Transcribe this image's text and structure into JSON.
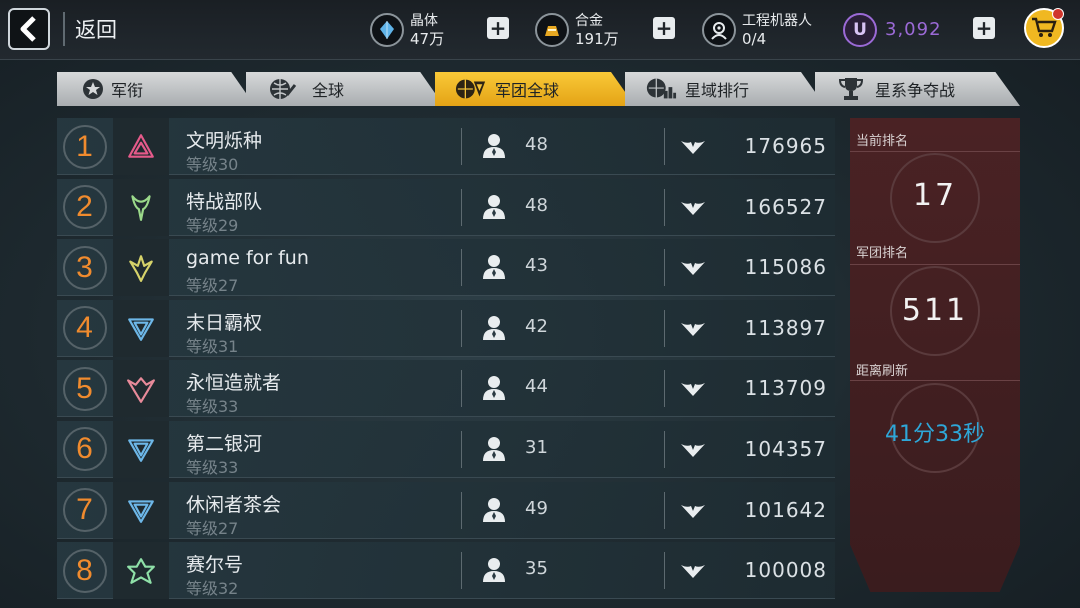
{
  "topbar": {
    "back_label": "返回",
    "resources": [
      {
        "name": "晶体",
        "value": "47万"
      },
      {
        "name": "合金",
        "value": "191万"
      },
      {
        "name": "工程机器人",
        "value": "0/4"
      }
    ],
    "currency_value": "3,092",
    "currency_color": "#9b6ad6"
  },
  "tabs": [
    {
      "label": "军衔",
      "icon": "rank-badge-icon",
      "active": false
    },
    {
      "label": "全球",
      "icon": "globe-icon",
      "active": false
    },
    {
      "label": "军团全球",
      "icon": "legion-globe-icon",
      "active": true
    },
    {
      "label": "星域排行",
      "icon": "galaxy-icon",
      "active": false
    },
    {
      "label": "星系争夺战",
      "icon": "trophy-icon",
      "active": false
    }
  ],
  "rows": [
    {
      "rank": "1",
      "name": "文明烁种",
      "level": "等级30",
      "members": "48",
      "power": "176965",
      "emblem_color": "#e55a8a"
    },
    {
      "rank": "2",
      "name": "特战部队",
      "level": "等级29",
      "members": "48",
      "power": "166527",
      "emblem_color": "#9bd98a"
    },
    {
      "rank": "3",
      "name": "game for fun",
      "level": "等级27",
      "members": "43",
      "power": "115086",
      "emblem_color": "#d6d36a"
    },
    {
      "rank": "4",
      "name": "末日霸权",
      "level": "等级31",
      "members": "42",
      "power": "113897",
      "emblem_color": "#6db7e8"
    },
    {
      "rank": "5",
      "name": "永恒造就者",
      "level": "等级33",
      "members": "44",
      "power": "113709",
      "emblem_color": "#e88a9a"
    },
    {
      "rank": "6",
      "name": "第二银河",
      "level": "等级33",
      "members": "31",
      "power": "104357",
      "emblem_color": "#6db7e8"
    },
    {
      "rank": "7",
      "name": "休闲者茶会",
      "level": "等级27",
      "members": "49",
      "power": "101642",
      "emblem_color": "#6db7e8"
    },
    {
      "rank": "8",
      "name": "赛尔号",
      "level": "等级32",
      "members": "35",
      "power": "100008",
      "emblem_color": "#8fe0a8"
    }
  ],
  "panel": {
    "current_rank_label": "当前排名",
    "current_rank": "17",
    "legion_rank_label": "军团排名",
    "legion_rank": "511",
    "refresh_label": "距离刷新",
    "refresh_time": "41分33秒"
  },
  "colors": {
    "accent": "#f4b92a",
    "rank_number": "#f08b2e",
    "timer": "#2ea7d8"
  }
}
